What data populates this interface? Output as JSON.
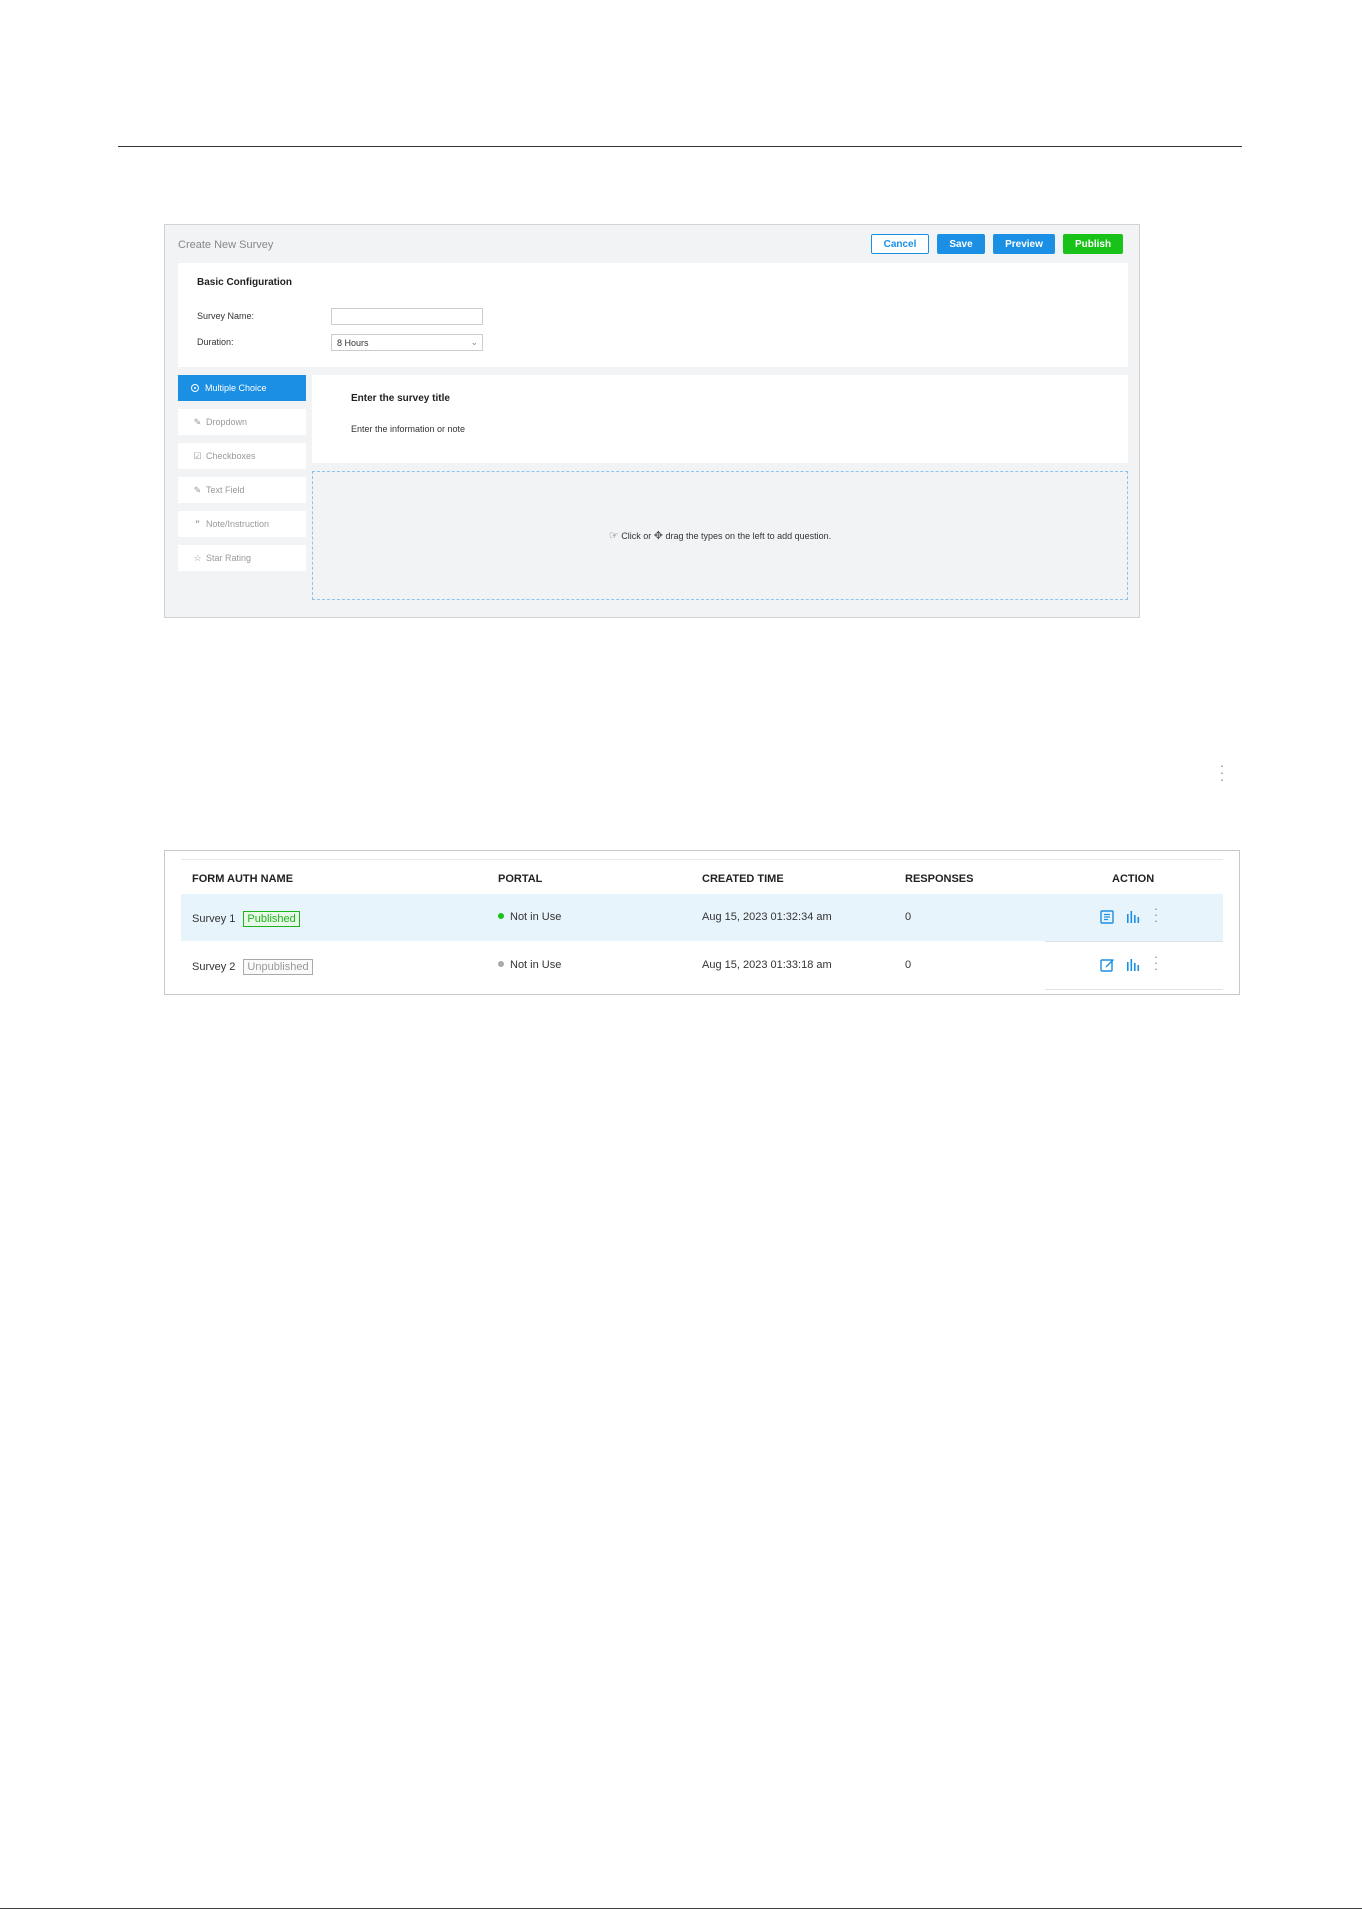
{
  "editor": {
    "title": "Create New Survey",
    "buttons": {
      "cancel": "Cancel",
      "save": "Save",
      "preview": "Preview",
      "publish": "Publish"
    },
    "basic_config": {
      "heading": "Basic Configuration",
      "survey_name_label": "Survey Name:",
      "survey_name_value": "",
      "duration_label": "Duration:",
      "duration_value": "8 Hours"
    },
    "question_types": [
      {
        "label": "Multiple Choice",
        "icon": "radio-icon",
        "active": true
      },
      {
        "label": "Dropdown",
        "icon": "edit-icon",
        "active": false
      },
      {
        "label": "Checkboxes",
        "icon": "checkbox-icon",
        "active": false
      },
      {
        "label": "Text Field",
        "icon": "edit-icon",
        "active": false
      },
      {
        "label": "Note/Instruction",
        "icon": "quote-icon",
        "active": false
      },
      {
        "label": "Star Rating",
        "icon": "star-icon",
        "active": false
      }
    ],
    "survey_header": {
      "title": "Enter the survey title",
      "note": "Enter the information or note"
    },
    "dropzone": {
      "part1": "Click or",
      "part2": "drag the types on the left to add question."
    }
  },
  "table": {
    "headers": [
      "FORM AUTH NAME",
      "PORTAL",
      "CREATED TIME",
      "RESPONSES",
      "ACTION"
    ],
    "rows": [
      {
        "name": "Survey 1",
        "status": "Published",
        "portal": "Not in Use",
        "created": "Aug 15, 2023 01:32:34 am",
        "responses": "0",
        "action_icon": "view-icon"
      },
      {
        "name": "Survey 2",
        "status": "Unpublished",
        "portal": "Not in Use",
        "created": "Aug 15, 2023 01:33:18 am",
        "responses": "0",
        "action_icon": "edit-icon"
      }
    ]
  },
  "colors": {
    "primary": "#1a8fe3",
    "publish": "#18c218",
    "row_highlight": "#e8f4fc"
  }
}
